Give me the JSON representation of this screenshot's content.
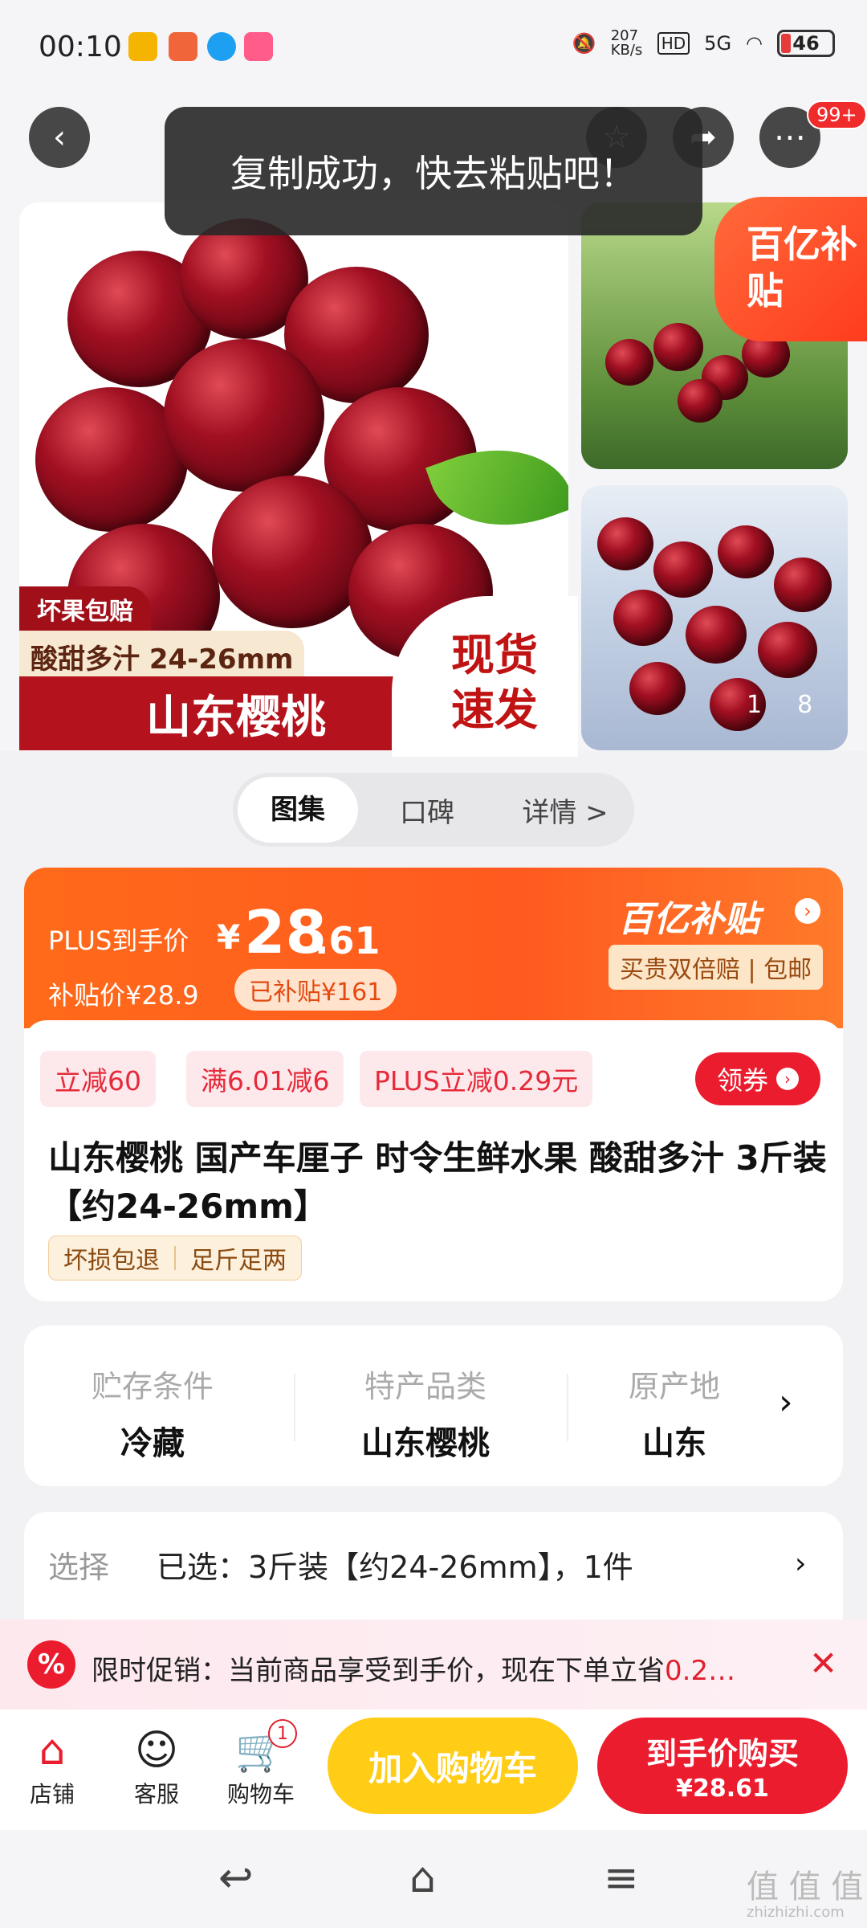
{
  "status_bar": {
    "time": "00:10",
    "network_speed": "207 KB/s",
    "hd": "HD",
    "signal": "5G",
    "battery": "46"
  },
  "nav": {
    "more_badge": "99+"
  },
  "toast": "复制成功，快去粘贴吧！",
  "gallery": {
    "main_tag_damage": "坏果包赔",
    "main_tag_sweet": "酸甜多汁 24-26mm",
    "main_tag_title": "山东樱桃",
    "main_tag_fast": "现货速发",
    "subsidy_corner": "百亿补贴",
    "page_current": "1",
    "page_total": "8"
  },
  "tabs": [
    "图集",
    "口碑",
    "详情 >"
  ],
  "price": {
    "plus_label": "PLUS到手价",
    "plus_currency": "¥",
    "plus_int": "28",
    "plus_dec": ".61",
    "sub_price": "补贴价¥28.9",
    "sub_done": "已补贴¥161",
    "brand": "百亿补贴",
    "brand_tags": "买贵双倍赔 | 包邮"
  },
  "chips": [
    "立减60",
    "满6.01减6",
    "PLUS立减0.29元"
  ],
  "coupon_label": "领券",
  "product_title": "山东樱桃  国产车厘子 时令生鲜水果 酸甜多汁 3斤装【约24-26mm】",
  "guarantees": [
    "坏损包退",
    "足斤足两"
  ],
  "attributes": [
    {
      "key": "贮存条件",
      "value": "冷藏"
    },
    {
      "key": "特产品类",
      "value": "山东樱桃"
    },
    {
      "key": "原产地",
      "value": "山东"
    }
  ],
  "select": {
    "label": "选择",
    "value": "已选：3斤装【约24-26mm】，1件"
  },
  "promo": {
    "text": "限时促销：当前商品享受到手价，现在下单立省",
    "highlight": "0.2…"
  },
  "bottom": {
    "shop": "店铺",
    "service": "客服",
    "cart": "购物车",
    "cart_count": "1",
    "add_cart": "加入购物车",
    "buy_label": "到手价购买",
    "buy_price": "¥28.61"
  },
  "watermark": "值 值 值",
  "watermark_url": "zhizhizhi.com"
}
